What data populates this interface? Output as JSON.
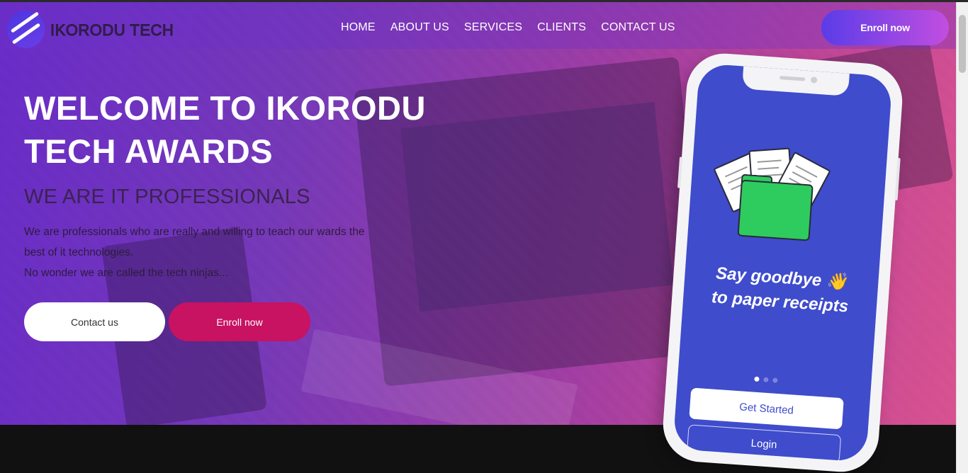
{
  "brand": {
    "name": "IKORODU TECH"
  },
  "nav": {
    "links": [
      "HOME",
      "ABOUT US",
      "SERVICES",
      "CLIENTS",
      "CONTACT US"
    ],
    "enroll_label": "Enroll now"
  },
  "hero": {
    "title_line1": "WELCOME TO IKORODU",
    "title_line2": "TECH AWARDS",
    "subtitle": "WE ARE IT PROFESSIONALS",
    "desc_line1": "We are professionals who are really and willing to teach our wards the",
    "desc_line2": "best of it technologies.",
    "desc_line3": "No wonder we are called the tech ninjas...",
    "contact_label": "Contact us",
    "enroll_label": "Enroll now"
  },
  "phone": {
    "title_line1": "Say goodbye 👋",
    "title_line2": "to paper receipts",
    "carousel_dots": 3,
    "active_dot": 1,
    "get_started_label": "Get Started",
    "login_label": "Login"
  },
  "colors": {
    "accent_purple": "#6c2cd0",
    "accent_pink": "#e8569a",
    "enroll_button": "#c81262",
    "phone_screen": "#3f4ccc",
    "folder_green": "#2ecc5e"
  },
  "icons": [
    "logo-slash-icon",
    "document-icon",
    "folder-icon",
    "waving-hand-icon"
  ]
}
